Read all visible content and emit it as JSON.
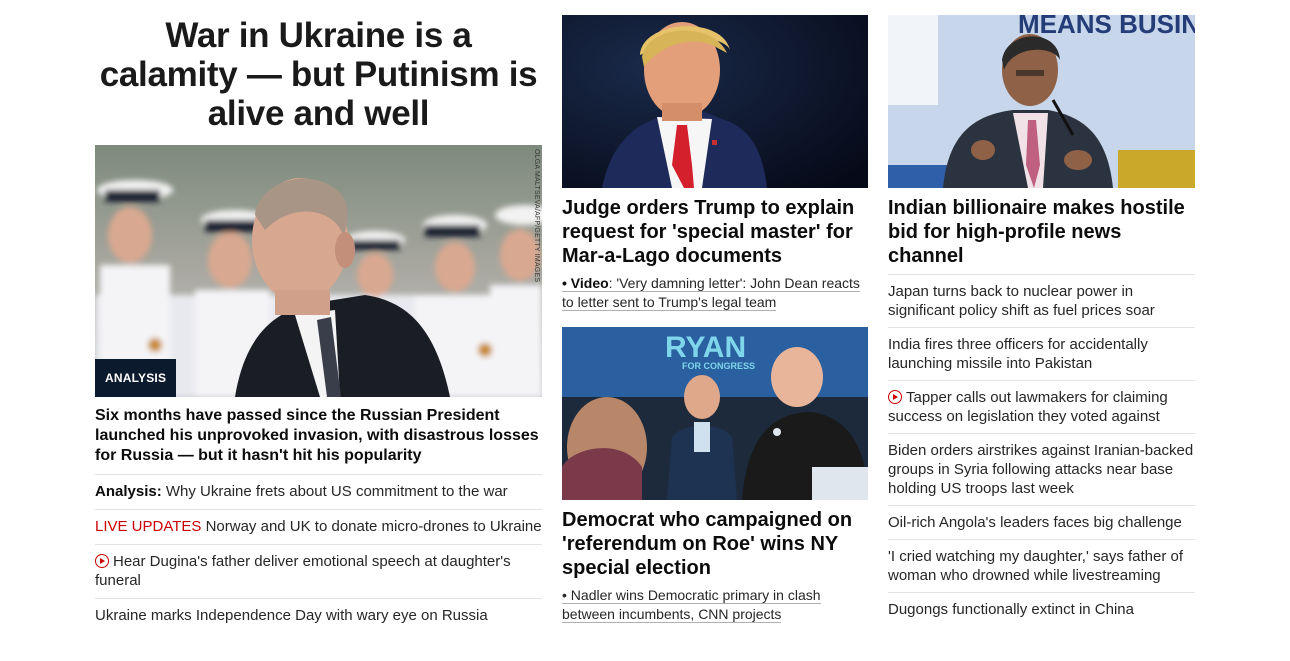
{
  "col1": {
    "title": "War in Ukraine is a calamity — but Putinism is alive and well",
    "badge": "ANALYSIS",
    "photo_credit": "OLGA MALTSEVA/AFP/GETTY IMAGES",
    "lead": "Six months have passed since the Russian President launched his unprovoked invasion, with disastrous losses for Russia — but it hasn't hit his popularity",
    "items": [
      {
        "prefix": "Analysis:",
        "text": " Why Ukraine frets about US commitment to the war"
      },
      {
        "prefix": "LIVE UPDATES",
        "text": " Norway and UK to donate micro-drones to Ukraine"
      },
      {
        "text": "Hear Dugina's father deliver emotional speech at daughter's funeral"
      },
      {
        "text": "Ukraine marks Independence Day with wary eye on Russia"
      }
    ]
  },
  "col2": {
    "story1": {
      "headline": "Judge orders Trump to explain request for 'special master' for Mar-a-Lago documents",
      "sub_prefix": "• Video",
      "sub_text": ": 'Very damning letter': John Dean reacts to letter sent to Trump's legal team"
    },
    "story2": {
      "sign_text": "RYAN",
      "sign_sub": "FOR CONGRESS",
      "headline": "Democrat who campaigned on 'referendum on Roe' wins NY special election",
      "sub_text": "• Nadler wins Democratic primary in clash between incumbents, CNN projects"
    }
  },
  "col3": {
    "backdrop_text": "MEANS BUSINESS",
    "headline": "Indian billionaire makes hostile bid for high-profile news channel",
    "items": [
      {
        "text": "Japan turns back to nuclear power in significant policy shift as fuel prices soar"
      },
      {
        "text": "India fires three officers for accidentally launching missile into Pakistan"
      },
      {
        "text": "Tapper calls out lawmakers for claiming success on legislation they voted against"
      },
      {
        "text": "Biden orders airstrikes against Iranian-backed groups in Syria following attacks near base holding US troops last week"
      },
      {
        "text": "Oil-rich Angola's leaders faces big challenge"
      },
      {
        "text": "'I cried watching my daughter,' says father of woman who drowned while livestreaming"
      },
      {
        "text": "Dugongs functionally extinct in China"
      }
    ]
  },
  "colors": {
    "live": "#cc0000",
    "badge_bg": "#0c1a2e"
  }
}
